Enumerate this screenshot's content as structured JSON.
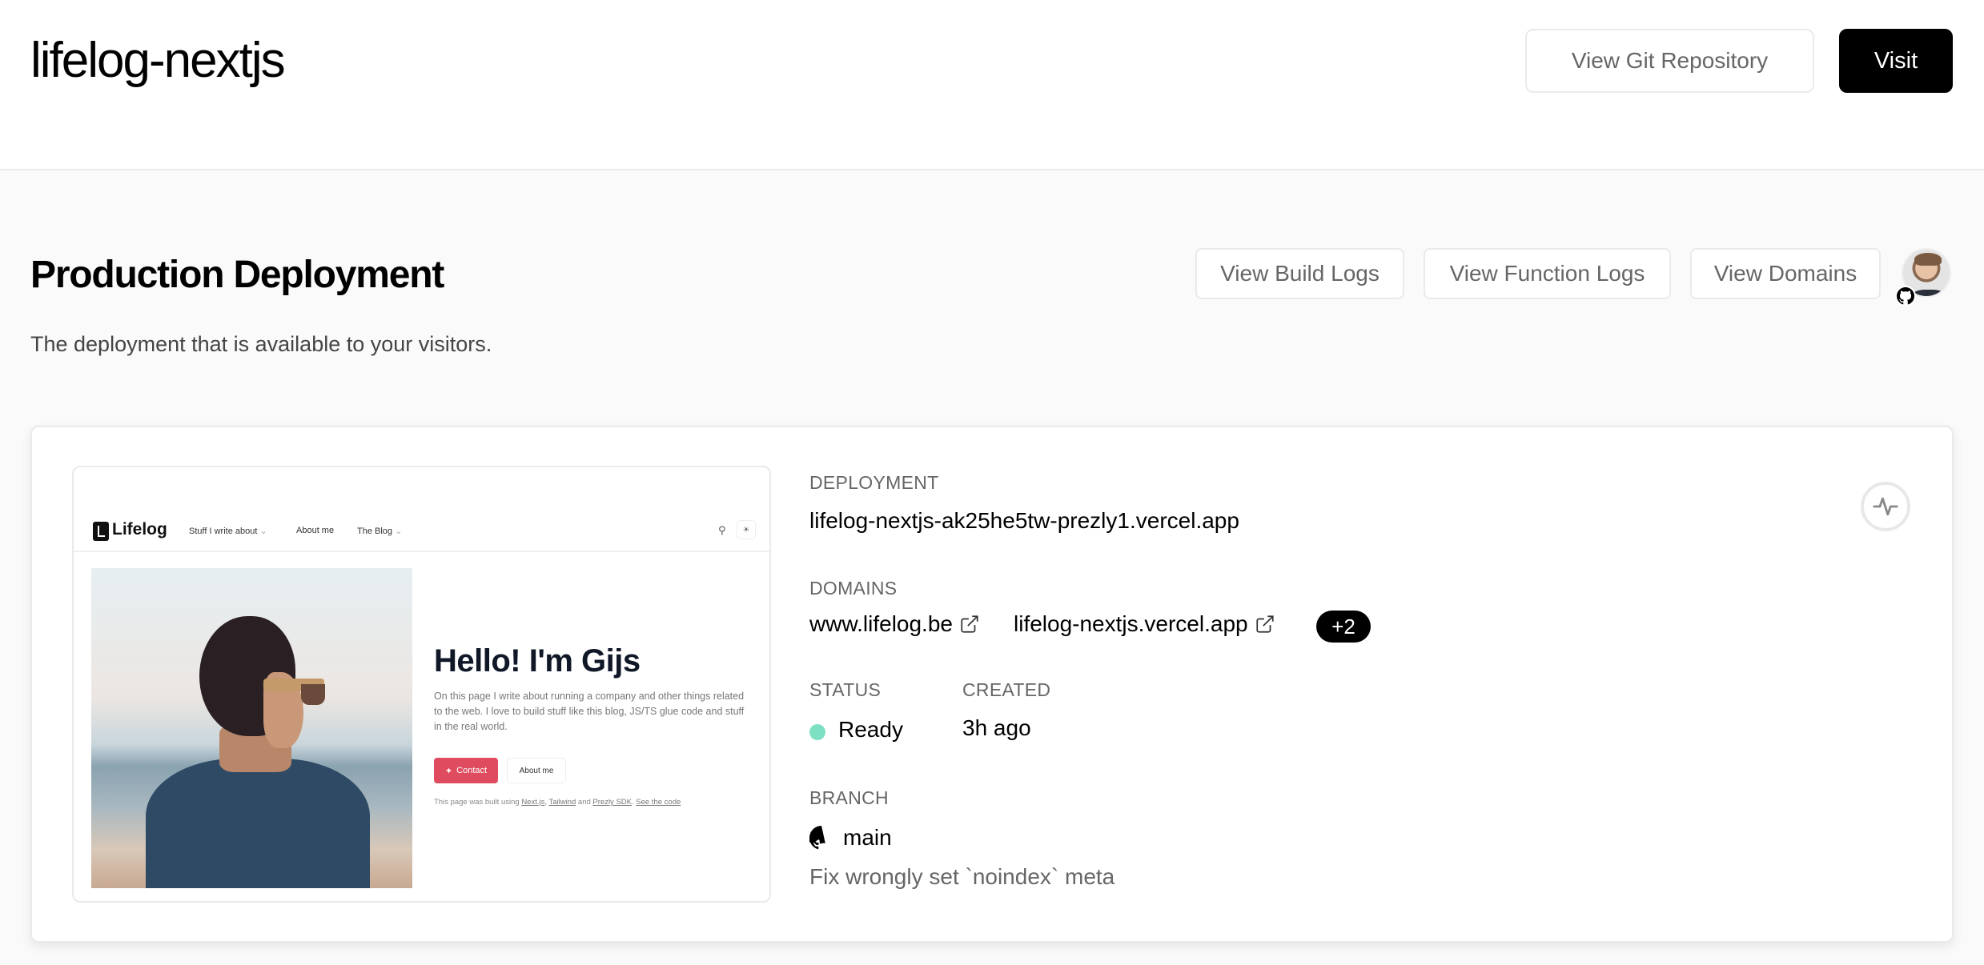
{
  "header": {
    "project_title": "lifelog-nextjs",
    "view_git_label": "View Git Repository",
    "visit_label": "Visit"
  },
  "production": {
    "title": "Production Deployment",
    "subtitle": "The deployment that is available to your visitors.",
    "buttons": {
      "build_logs": "View Build Logs",
      "function_logs": "View Function Logs",
      "domains": "View Domains"
    },
    "avatar_icon": "user-avatar",
    "avatar_badge_icon": "github-icon"
  },
  "deployment_card": {
    "deployment_label": "DEPLOYMENT",
    "deployment_url": "lifelog-nextjs-ak25he5tw-prezly1.vercel.app",
    "domains_label": "DOMAINS",
    "domains": [
      {
        "name": "www.lifelog.be",
        "icon": "external-link-icon"
      },
      {
        "name": "lifelog-nextjs.vercel.app",
        "icon": "external-link-icon"
      }
    ],
    "domains_more": "+2",
    "status_label": "STATUS",
    "status_value": "Ready",
    "status_color": "#7ee0c3",
    "created_label": "CREATED",
    "created_value": "3h ago",
    "branch_label": "BRANCH",
    "branch_icon": "github-icon",
    "branch_value": "main",
    "commit_message": "Fix wrongly set `noindex` meta",
    "activity_icon": "activity-pulse-icon"
  },
  "preview": {
    "logo_text": "Lifelog",
    "nav": [
      "Stuff I write about",
      "About me",
      "The Blog"
    ],
    "heading": "Hello! I'm Gijs",
    "description": "On this page I write about running a company and other things related to the web. I love to build stuff like this blog, JS/TS glue code and stuff in the real world.",
    "contact_label": "Contact",
    "about_label": "About me",
    "built_prefix": "This page was built using",
    "built_links": [
      "Next.js",
      "Tailwind",
      "Prezly SDK",
      "See the code"
    ],
    "built_and": "and",
    "accent_color": "#e04c5f"
  }
}
